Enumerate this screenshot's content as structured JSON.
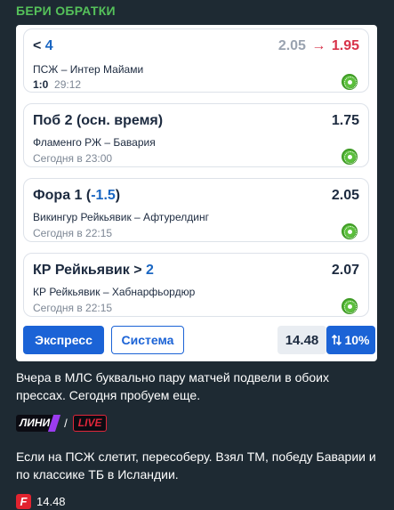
{
  "channel": {
    "title": "БЕРИ ОБРАТКИ"
  },
  "bets": [
    {
      "pick": "< ",
      "pick_hl": "4",
      "pick_tail": "",
      "odd_old": "2.05",
      "odd_arrow": "→",
      "odd": "1.95",
      "match": "ПСЖ – Интер Майами",
      "score": "1:0",
      "time": "29:12",
      "sport_icon": "soccer-ball-icon"
    },
    {
      "pick": "Поб 2 (осн. время)",
      "pick_hl": "",
      "pick_tail": "",
      "odd": "1.75",
      "match": "Фламенго РЖ – Бавария",
      "time": "Сегодня в 23:00",
      "sport_icon": "soccer-ball-icon"
    },
    {
      "pick": "Фора 1 (",
      "pick_hl": "-1.5",
      "pick_tail": ")",
      "odd": "2.05",
      "match": "Викингур Рейкьявик – Афтурелдинг",
      "time": "Сегодня в 22:15",
      "sport_icon": "soccer-ball-icon"
    },
    {
      "pick": "КР Рейкьявик > ",
      "pick_hl": "2",
      "pick_tail": "",
      "odd": "2.07",
      "match": "КР Рейкьявик – Хабнарфьордюр",
      "time": "Сегодня в 22:15",
      "sport_icon": "soccer-ball-icon"
    }
  ],
  "coupon": {
    "express_label": "Экспресс",
    "system_label": "Система",
    "total_odd": "14.48",
    "boost_icon": "sort-arrows-icon",
    "boost_label": "10%"
  },
  "message": {
    "para1": "Вчера в МЛС буквально пару матчей подвели в обоих прессах. Сегодня пробуем еще.",
    "link_line": "ЛИНИ",
    "link_sep": "/",
    "link_live": "LIVE",
    "para2": "Если на ПСЖ слетит, пересоберу. Взял ТМ, победу Баварии и по классике ТБ в Исландии.",
    "footer_logo": "F",
    "footer_value": "14.48"
  },
  "colors": {
    "accent_green": "#55c15a",
    "accent_blue": "#1b63d6",
    "odd_drop": "#d8334a",
    "background": "#1e2a33"
  }
}
